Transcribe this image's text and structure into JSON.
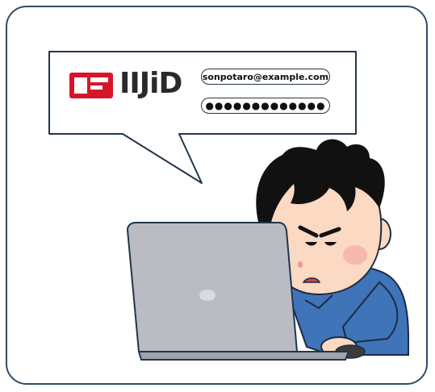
{
  "logo": {
    "text": "IIJiD",
    "brand_color": "#d7152a",
    "dot_color": "#d7152a"
  },
  "login": {
    "email": "sonpotaro@example.com",
    "password_mask": "●●●●●●●●●●●●●"
  },
  "colors": {
    "frame": "#2f4d67",
    "laptop": "#b9bcc3",
    "shirt": "#3f74b8",
    "skin": "#fbd9c2",
    "hair": "#111111"
  }
}
